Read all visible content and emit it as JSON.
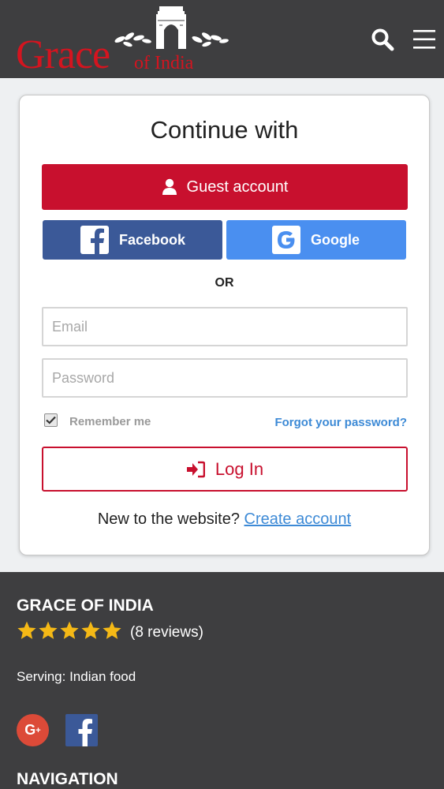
{
  "header": {
    "logo_main": "Grace",
    "logo_sub": "of India"
  },
  "card": {
    "title": "Continue with",
    "guest_label": "Guest account",
    "facebook_label": "Facebook",
    "google_label": "Google",
    "or_label": "OR",
    "email_placeholder": "Email",
    "password_placeholder": "Password",
    "remember_label": "Remember me",
    "remember_checked": true,
    "forgot_label": "Forgot your password?",
    "login_label": "Log In",
    "new_text": "New to the website?",
    "create_label": "Create account"
  },
  "footer": {
    "title": "GRACE OF INDIA",
    "rating": 5,
    "reviews": "(8 reviews)",
    "serving": "Serving: Indian food",
    "nav_title": "NAVIGATION"
  },
  "colors": {
    "header_bg": "#3e3e40",
    "brand_red": "#c8102e",
    "facebook": "#3b5998",
    "google": "#4a8ff0",
    "link": "#3d8ad6",
    "star": "#f5b916"
  },
  "icons": {
    "header": [
      "search-icon",
      "menu-icon"
    ],
    "guest": "user-icon",
    "facebook": "facebook-icon",
    "google": "google-icon",
    "login": "sign-in-icon",
    "footer_social": [
      "google-plus-icon",
      "facebook-icon"
    ]
  }
}
